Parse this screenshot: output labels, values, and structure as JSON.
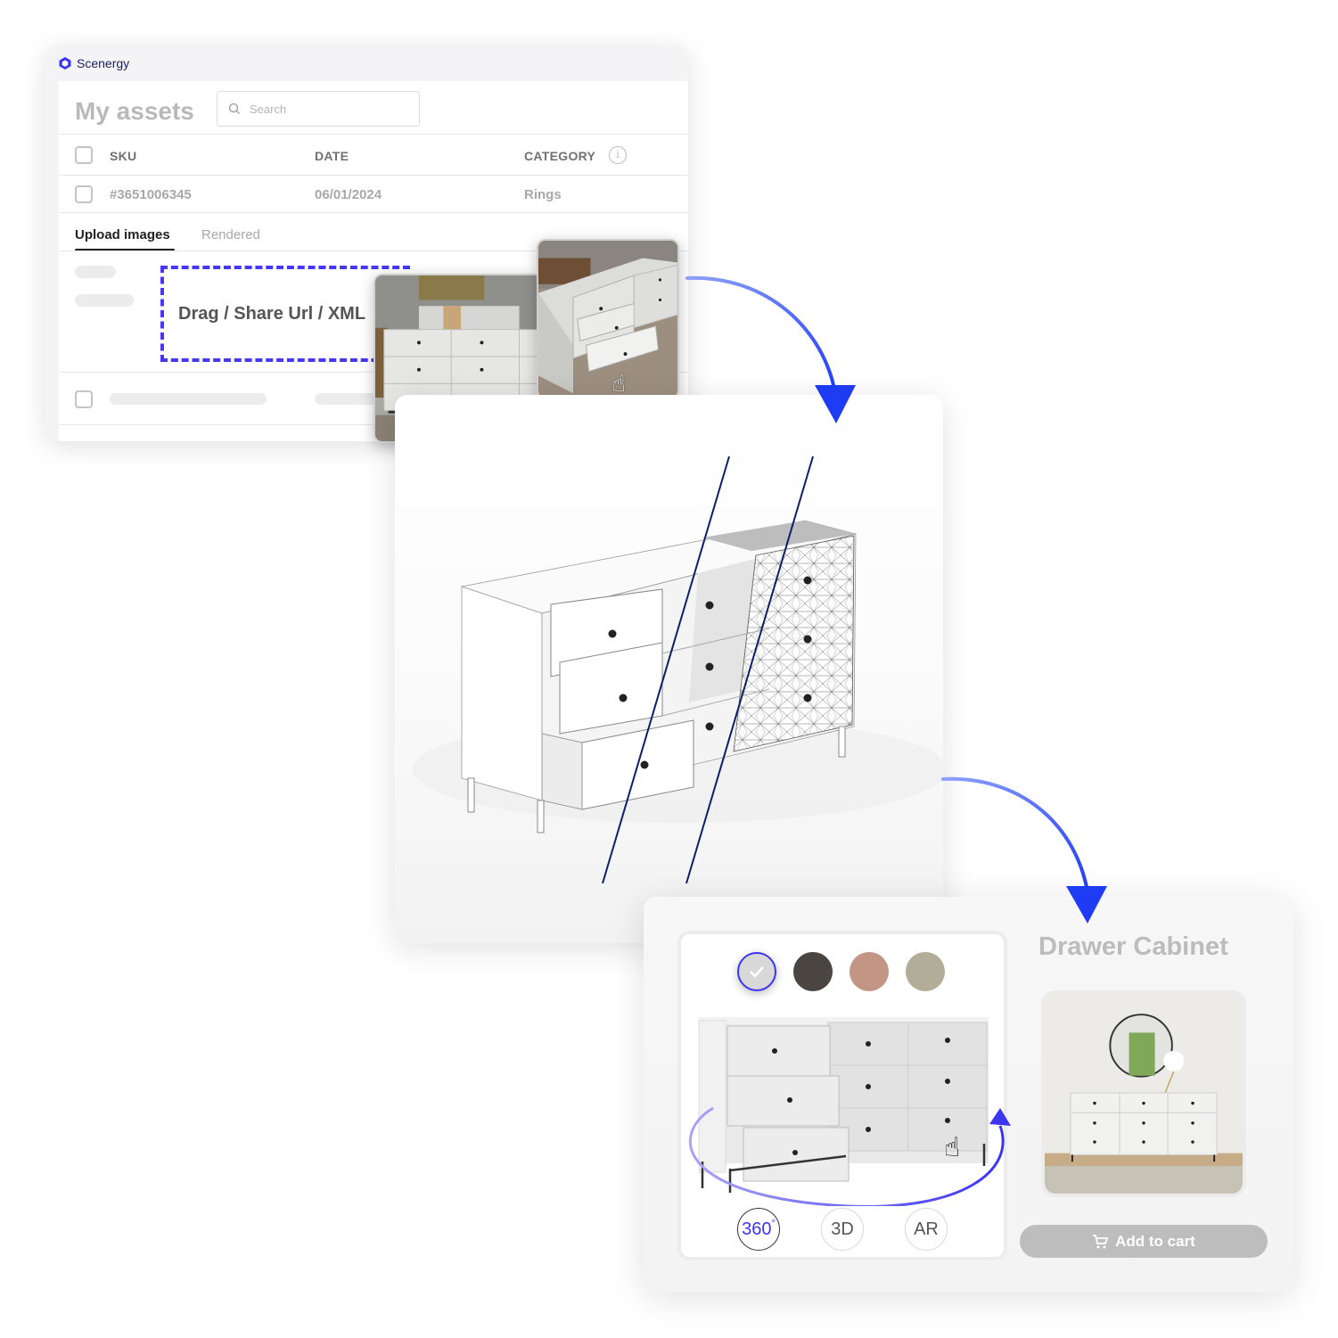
{
  "app": {
    "brand_name": "Scenergy",
    "page_title": "My assets",
    "search_placeholder": "Search"
  },
  "table": {
    "headers": [
      "SKU",
      "DATE",
      "CATEGORY"
    ],
    "rows": [
      {
        "sku": "#3651006345",
        "date": "06/01/2024",
        "category": "Rings"
      }
    ]
  },
  "tabs": [
    {
      "label": "Upload images",
      "active": true
    },
    {
      "label": "Rendered",
      "active": false
    }
  ],
  "dropzone": {
    "label": "Drag / Share Url / XML"
  },
  "product": {
    "title": "Drawer Cabinet",
    "color_swatches": [
      {
        "name": "light-gray",
        "hex": "#d8d8d8",
        "selected": true
      },
      {
        "name": "charcoal",
        "hex": "#4a4541",
        "selected": false
      },
      {
        "name": "rose",
        "hex": "#c39585",
        "selected": false
      },
      {
        "name": "sage",
        "hex": "#b1ad98",
        "selected": false
      }
    ],
    "view_modes": [
      {
        "label": "360",
        "suffix": "°",
        "active": true
      },
      {
        "label": "3D",
        "active": false
      },
      {
        "label": "AR",
        "active": false
      }
    ],
    "add_to_cart_label": "Add to cart"
  },
  "colors": {
    "accent": "#3b34f0",
    "arrow": "#1f3cf5",
    "dropzone_border": "#4637f2",
    "wire_line": "#0d1f66"
  }
}
